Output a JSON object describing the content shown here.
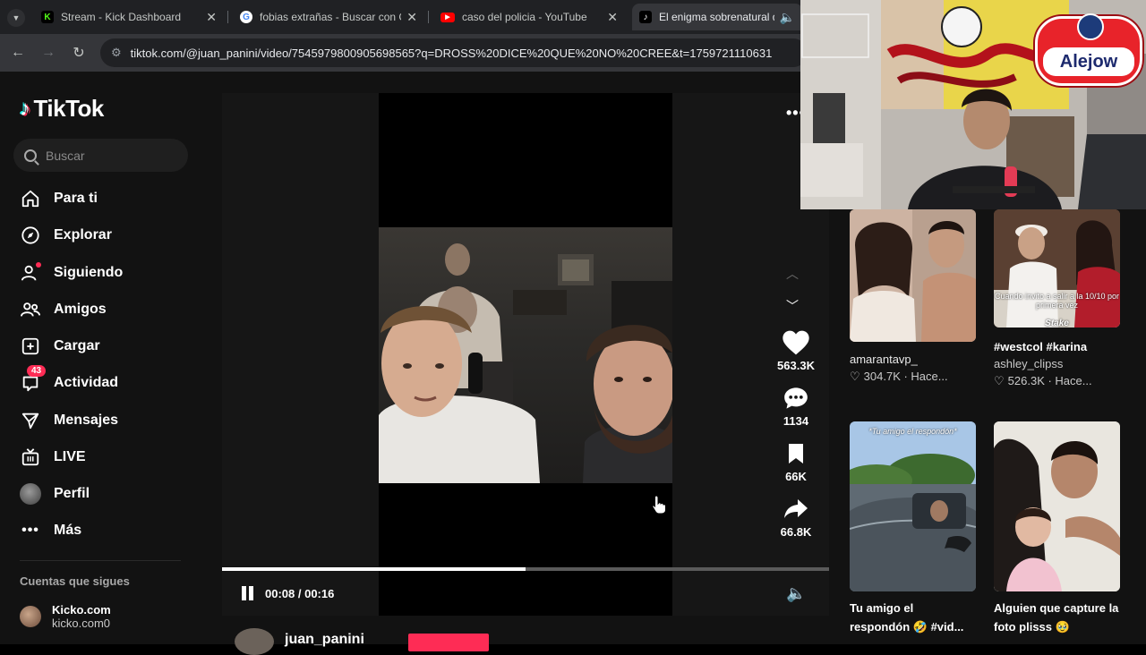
{
  "browser": {
    "tabs": [
      {
        "title": "Stream - Kick Dashboard",
        "favicon": "kick-icon"
      },
      {
        "title": "fobias extrañas - Buscar con Go",
        "favicon": "google-icon"
      },
      {
        "title": "caso del policia - YouTube",
        "favicon": "youtube-icon"
      },
      {
        "title": "El enigma sobrenatural que",
        "favicon": "tiktok-icon"
      }
    ],
    "url": "tiktok.com/@juan_panini/video/7545979800905698565?q=DROSS%20DICE%20QUE%20NO%20CREE&t=1759721110631"
  },
  "tiktok": {
    "logo": "TikTok",
    "search_placeholder": "Buscar",
    "nav": [
      {
        "label": "Para ti",
        "icon": "home-icon"
      },
      {
        "label": "Explorar",
        "icon": "compass-icon"
      },
      {
        "label": "Siguiendo",
        "icon": "following-icon"
      },
      {
        "label": "Amigos",
        "icon": "friends-icon"
      },
      {
        "label": "Cargar",
        "icon": "upload-icon"
      },
      {
        "label": "Actividad",
        "icon": "inbox-icon",
        "badge": "43"
      },
      {
        "label": "Mensajes",
        "icon": "send-icon"
      },
      {
        "label": "LIVE",
        "icon": "live-icon"
      },
      {
        "label": "Perfil",
        "icon": "profile-avatar"
      },
      {
        "label": "Más",
        "icon": "more-icon"
      }
    ],
    "following_header": "Cuentas que sigues",
    "following": [
      {
        "name": "Kicko.com",
        "handle": "kicko.com0"
      }
    ]
  },
  "player": {
    "time": "00:08 / 00:16",
    "progress": 0.5,
    "actions": [
      {
        "name": "like",
        "count": "563.3K"
      },
      {
        "name": "comment",
        "count": "1134"
      },
      {
        "name": "save",
        "count": "66K"
      },
      {
        "name": "share",
        "count": "66.8K"
      }
    ],
    "author": "juan_panini"
  },
  "recommended": [
    {
      "title": "amarantavp_",
      "likes": "304.7K",
      "time": "Hace...",
      "caption": ""
    },
    {
      "title": "#westcol #karina",
      "author": "ashley_clipss",
      "likes": "526.3K",
      "time": "Hace...",
      "caption": "Cuando invito a salir a la 10/10 por primera vez",
      "watermark": "Stake"
    },
    {
      "title": "Tu amigo el respondón 🤣 #vid...",
      "caption": "*Tu amigo el respondón*"
    },
    {
      "title": "Alguien que capture la foto plisss 🥹"
    }
  ],
  "webcam": {
    "overlay_label": "Alejow"
  },
  "colors": {
    "tiktok_red": "#fe2c55",
    "tiktok_cyan": "#25f4ee",
    "bg": "#121212"
  }
}
